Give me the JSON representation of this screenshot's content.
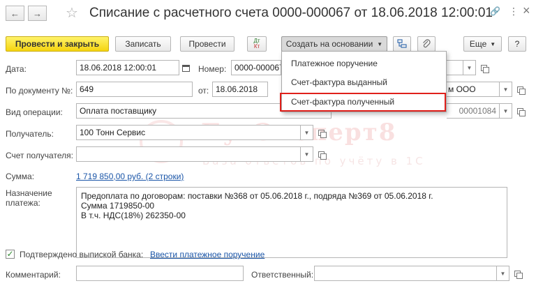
{
  "window": {
    "title": "Списание с расчетного счета 0000-000067 от 18.06.2018 12:00:01",
    "back_glyph": "←",
    "forward_glyph": "→",
    "star_glyph": "☆",
    "link_glyph": "🔗",
    "more_glyph": "⋮",
    "close_glyph": "×"
  },
  "toolbar": {
    "post_and_close": "Провести и закрыть",
    "save": "Записать",
    "post": "Провести",
    "dtkt_top": "Дт",
    "dtkt_bottom": "Кт",
    "create_based_on": "Создать на основании",
    "more": "Еще",
    "help": "?"
  },
  "dropdown_menu": {
    "items": [
      {
        "label": "Платежное поручение"
      },
      {
        "label": "Счет-фактура выданный"
      },
      {
        "label": "Счет-фактура полученный"
      }
    ],
    "highlighted_index": 2
  },
  "form": {
    "date_label": "Дата:",
    "date_value": "18.06.2018 12:00:01",
    "number_label": "Номер:",
    "number_value": "0000-000067",
    "doc_number_label": "По документу №:",
    "doc_number_value": "649",
    "from_label": "от:",
    "from_value": "18.06.2018",
    "org_value_visible": "м ООО",
    "operation_label": "Вид операции:",
    "operation_value": "Оплата поставщику",
    "bank_account_visible": "00001084",
    "recipient_label": "Получатель:",
    "recipient_value": "100 Тонн Сервис",
    "recipient_account_label": "Счет получателя:",
    "recipient_account_value": "",
    "amount_label": "Сумма:",
    "amount_link": "1 719 850,00 руб. (2 строки)",
    "purpose_label_line1": "Назначение",
    "purpose_label_line2": "платежа:",
    "purpose_lines": [
      "Предоплата по договорам: поставки №368 от 05.06.2018 г., подряда №369 от 05.06.2018 г.",
      "Сумма 1719850-00",
      "В т.ч. НДС(18%) 262350-00"
    ],
    "confirmed_label": "Подтверждено выпиской банка:",
    "confirmed_checked": true,
    "enter_payment_link": "Ввести платежное поручение",
    "comment_label": "Комментарий:",
    "comment_value": "",
    "responsible_label": "Ответственный:",
    "responsible_value": ""
  },
  "watermark": {
    "line1": "БухЭксперт8",
    "line2": "База ответов по учёту в 1С"
  },
  "colors": {
    "primary_button": "#f5d40f",
    "highlight_border": "#e0201b",
    "link": "#1b56a8"
  }
}
